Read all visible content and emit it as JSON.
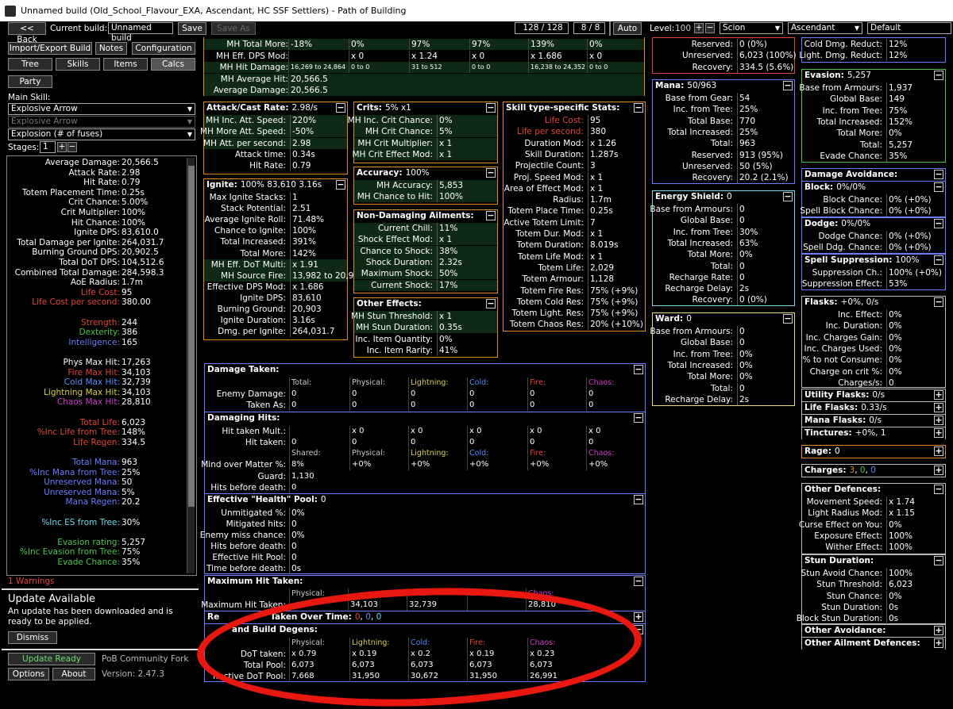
{
  "window": {
    "title": "Unnamed build (Old_School_Flavour_EXA, Ascendant, HC SSF Settlers) - Path of Building"
  },
  "toolbar": {
    "back": "<< Back",
    "current_build_label": "Current build:",
    "build_name": "Unnamed build",
    "save": "Save",
    "save_as": "Save As",
    "points": "128 / 128",
    "ascend_points": "8 / 8",
    "auto": "Auto",
    "level_label": "Level:",
    "level": "100",
    "class": "Scion",
    "ascendancy": "Ascendant",
    "config": "Default"
  },
  "left": {
    "import_export": "Import/Export Build",
    "notes": "Notes",
    "configuration": "Configuration",
    "tabs": [
      "Tree",
      "Skills",
      "Items",
      "Calcs"
    ],
    "party": "Party",
    "main_skill_label": "Main Skill:",
    "main_skill": "Explosive Arrow",
    "sub_skill": "Explosive Arrow",
    "skill_part": "Explosion (# of fuses)",
    "stages_label": "Stages:",
    "stages": "1",
    "warnings": "1 Warnings",
    "update_title": "Update Available",
    "update_text": "An update has been downloaded and is ready to be applied.",
    "dismiss": "Dismiss",
    "update_ready": "Update Ready",
    "fork": "PoB Community Fork",
    "options": "Options",
    "about": "About",
    "version": "Version: 2.47.3"
  },
  "stats": [
    {
      "l": "Average Damage:",
      "v": "20,566.5",
      "c": "#ffffff"
    },
    {
      "l": "Attack Rate:",
      "v": "2.98",
      "c": "#ffffff"
    },
    {
      "l": "Hit Rate:",
      "v": "0.79",
      "c": "#ffffff"
    },
    {
      "l": "Totem Placement Time:",
      "v": "0.25s",
      "c": "#ffffff"
    },
    {
      "l": "Crit Chance:",
      "v": "5.00%",
      "c": "#ffffff"
    },
    {
      "l": "Crit Multiplier:",
      "v": "100%",
      "c": "#ffffff"
    },
    {
      "l": "Hit Chance:",
      "v": "100%",
      "c": "#ffffff"
    },
    {
      "l": "Ignite DPS:",
      "v": "83,610.0",
      "c": "#ffffff"
    },
    {
      "l": "Total Damage per Ignite:",
      "v": "264,031.7",
      "c": "#ffffff"
    },
    {
      "l": "Burning Ground DPS:",
      "v": "20,902.5",
      "c": "#ffffff"
    },
    {
      "l": "Total DoT DPS:",
      "v": "104,512.6",
      "c": "#ffffff"
    },
    {
      "l": "Combined Total Damage:",
      "v": "284,598.3",
      "c": "#ffffff"
    },
    {
      "l": "AoE Radius:",
      "v": "1.7m",
      "c": "#ffffff"
    },
    {
      "l": "Life Cost:",
      "v": "95",
      "c": "#e0453a"
    },
    {
      "l": "Life Cost per second:",
      "v": "380.00",
      "c": "#e0453a"
    },
    {
      "l": "",
      "v": "",
      "c": "#fff"
    },
    {
      "l": "Strength:",
      "v": "244",
      "c": "#e0453a"
    },
    {
      "l": "Dexterity:",
      "v": "386",
      "c": "#4ec24e"
    },
    {
      "l": "Intelligence:",
      "v": "165",
      "c": "#6a7cff"
    },
    {
      "l": "",
      "v": "",
      "c": "#fff"
    },
    {
      "l": "Phys Max Hit:",
      "v": "17,263",
      "c": "#ffffff"
    },
    {
      "l": "Fire Max Hit:",
      "v": "34,103",
      "c": "#e0453a"
    },
    {
      "l": "Cold Max Hit:",
      "v": "32,739",
      "c": "#5b8cff"
    },
    {
      "l": "Lightning Max Hit:",
      "v": "34,103",
      "c": "#d8d24a"
    },
    {
      "l": "Chaos Max Hit:",
      "v": "28,810",
      "c": "#d03cc9"
    },
    {
      "l": "",
      "v": "",
      "c": "#fff"
    },
    {
      "l": "Total Life:",
      "v": "6,023",
      "c": "#e0453a"
    },
    {
      "l": "%Inc Life from Tree:",
      "v": "148%",
      "c": "#e0453a"
    },
    {
      "l": "Life Regen:",
      "v": "334.5",
      "c": "#e0453a"
    },
    {
      "l": "",
      "v": "",
      "c": "#fff"
    },
    {
      "l": "Total Mana:",
      "v": "963",
      "c": "#6a7cff"
    },
    {
      "l": "%Inc Mana from Tree:",
      "v": "25%",
      "c": "#6a7cff"
    },
    {
      "l": "Unreserved Mana:",
      "v": "50",
      "c": "#6a7cff"
    },
    {
      "l": "Unreserved Mana:",
      "v": "5%",
      "c": "#6a7cff"
    },
    {
      "l": "Mana Regen:",
      "v": "20.2",
      "c": "#6a7cff"
    },
    {
      "l": "",
      "v": "",
      "c": "#fff"
    },
    {
      "l": "%Inc ES from Tree:",
      "v": "30%",
      "c": "#6fd9e8"
    },
    {
      "l": "",
      "v": "",
      "c": "#fff"
    },
    {
      "l": "Evasion rating:",
      "v": "5,257",
      "c": "#4ec24e"
    },
    {
      "l": "%Inc Evasion from Tree:",
      "v": "75%",
      "c": "#4ec24e"
    },
    {
      "l": "Evade Chance:",
      "v": "35%",
      "c": "#4ec24e"
    },
    {
      "l": "",
      "v": "",
      "c": "#fff"
    },
    {
      "l": "Armour:",
      "v": "11,296",
      "c": "#ffffff"
    },
    {
      "l": "%Inc Armour from Tree:",
      "v": "98%",
      "c": "#ffffff"
    },
    {
      "l": "Phys. Damage Reduction:",
      "v": "90%",
      "c": "#ffffff"
    },
    {
      "l": "Spell Suppression Chance:",
      "v": "100%",
      "c": "#ffffff"
    }
  ],
  "mh_top": {
    "rows": [
      {
        "l": "MH Total More:",
        "v": [
          "-18%",
          "0%",
          "97%",
          "97%",
          "139%",
          "0%"
        ]
      },
      {
        "l": "MH Eff. DPS Mod:",
        "v": [
          "",
          "x 0",
          "x 1.24",
          "x 0",
          "x 1.686",
          "x 0"
        ]
      },
      {
        "l": "MH Hit Damage:",
        "v": [
          "16,269 to 24,864",
          "0 to 0",
          "31 to 512",
          "0 to 0",
          "16,238 to 24,352",
          "0 to 0"
        ]
      },
      {
        "l": "MH Average Hit:",
        "v": [
          "20,566.5"
        ]
      },
      {
        "l": "Average Damage:",
        "v": [
          "20,566.5"
        ]
      }
    ]
  },
  "attack": {
    "title": "Attack/Cast Rate:",
    "value": "2.98/s",
    "rows": [
      {
        "l": "MH Inc. Att. Speed:",
        "v": "220%"
      },
      {
        "l": "MH More Att. Speed:",
        "v": "-50%"
      },
      {
        "l": "MH Att. per second:",
        "v": "2.98"
      },
      {
        "l": "Attack time:",
        "v": "0.34s"
      },
      {
        "l": "Hit Rate:",
        "v": "0.79"
      }
    ]
  },
  "ignite": {
    "title": "Ignite:",
    "value": "100% 83,610 3.16s",
    "rows": [
      {
        "l": "Max Ignite Stacks:",
        "v": "1"
      },
      {
        "l": "Stack Potential:",
        "v": "2.51"
      },
      {
        "l": "Average Ignite Roll:",
        "v": "71.48%"
      },
      {
        "l": "Chance to Ignite:",
        "v": "100%"
      },
      {
        "l": "Total Increased:",
        "v": "391%"
      },
      {
        "l": "Total More:",
        "v": "142%"
      },
      {
        "l": "MH Eff. DoT Multi:",
        "v": "x 1.91"
      },
      {
        "l": "MH Source Fire:",
        "v": "13,982 to 20,967"
      },
      {
        "l": "Effective DPS Mod:",
        "v": "x 1.686"
      },
      {
        "l": "Ignite DPS:",
        "v": "83,610"
      },
      {
        "l": "Burning Ground:",
        "v": "20,903"
      },
      {
        "l": "Ignite Duration:",
        "v": "3.16s"
      },
      {
        "l": "Dmg. per Ignite:",
        "v": "264,031.7"
      }
    ]
  },
  "crits": {
    "title": "Crits:",
    "value": "5% x1",
    "rows": [
      {
        "l": "MH Inc. Crit Chance:",
        "v": "0%"
      },
      {
        "l": "MH Crit Chance:",
        "v": "5%"
      },
      {
        "l": "MH Crit Multiplier:",
        "v": "x 1"
      },
      {
        "l": "MH Crit Effect Mod:",
        "v": "x 1"
      }
    ]
  },
  "accuracy": {
    "title": "Accuracy:",
    "value": "100%",
    "rows": [
      {
        "l": "MH Accuracy:",
        "v": "5,853"
      },
      {
        "l": "MH Chance to Hit:",
        "v": "100%"
      }
    ]
  },
  "nondmg": {
    "title": "Non-Damaging Ailments:",
    "rows": [
      {
        "l": "Current Chill:",
        "v": "11%"
      },
      {
        "l": "Shock Effect Mod:",
        "v": "x 1"
      },
      {
        "l": "Chance to Shock:",
        "v": "38%"
      },
      {
        "l": "Shock Duration:",
        "v": "2.32s"
      },
      {
        "l": "Maximum Shock:",
        "v": "50%"
      },
      {
        "l": "Current Shock:",
        "v": "17%"
      }
    ]
  },
  "other_effects": {
    "title": "Other Effects:",
    "rows": [
      {
        "l": "MH Stun Threshold:",
        "v": "x 1"
      },
      {
        "l": "MH Stun Duration:",
        "v": "0.35s"
      },
      {
        "l": "Inc. Item Quantity:",
        "v": "0%"
      },
      {
        "l": "Inc. Item Rarity:",
        "v": "41%"
      }
    ]
  },
  "skilltype": {
    "title": "Skill type-specific Stats:",
    "rows": [
      {
        "l": "Life Cost:",
        "v": "95",
        "c": "#e0453a"
      },
      {
        "l": "Life per second:",
        "v": "380",
        "c": "#e0453a"
      },
      {
        "l": "Duration Mod:",
        "v": "x 1.26",
        "c": "#fff"
      },
      {
        "l": "Skill Duration:",
        "v": "1.287s",
        "c": "#fff"
      },
      {
        "l": "Projectile Count:",
        "v": "3",
        "c": "#fff"
      },
      {
        "l": "Proj. Speed Mod:",
        "v": "x 1",
        "c": "#fff"
      },
      {
        "l": "Area of Effect Mod:",
        "v": "x 1",
        "c": "#fff"
      },
      {
        "l": "Radius:",
        "v": "1.7m",
        "c": "#fff"
      },
      {
        "l": "Totem Place Time:",
        "v": "0.25s",
        "c": "#fff"
      },
      {
        "l": "Active Totem Limit:",
        "v": "7",
        "c": "#fff"
      },
      {
        "l": "Totem Dur. Mod:",
        "v": "x 1",
        "c": "#fff"
      },
      {
        "l": "Totem Duration:",
        "v": "8.019s",
        "c": "#fff"
      },
      {
        "l": "Totem Life Mod:",
        "v": "x 1",
        "c": "#fff"
      },
      {
        "l": "Totem Life:",
        "v": "2,029",
        "c": "#fff"
      },
      {
        "l": "Totem Armour:",
        "v": "1,128",
        "c": "#fff"
      },
      {
        "l": "Totem Fire Res:",
        "v": "75% (+9%)",
        "c": "#fff"
      },
      {
        "l": "Totem Cold Res:",
        "v": "75% (+9%)",
        "c": "#fff"
      },
      {
        "l": "Totem Light. Res:",
        "v": "75% (+9%)",
        "c": "#fff"
      },
      {
        "l": "Totem Chaos Res:",
        "v": "20% (+10%)",
        "c": "#fff"
      }
    ]
  },
  "life_top": {
    "rows": [
      {
        "l": "Reserved:",
        "v": "0 (0%)"
      },
      {
        "l": "Unreserved:",
        "v": "6,023 (100%)"
      },
      {
        "l": "Recovery:",
        "v": "334.5 (5.6%)"
      }
    ]
  },
  "mana": {
    "title": "Mana:",
    "value": "50/963",
    "rows": [
      {
        "l": "Base from Gear:",
        "v": "54"
      },
      {
        "l": "Inc. from Tree:",
        "v": "25%"
      },
      {
        "l": "Total Base:",
        "v": "770"
      },
      {
        "l": "Total Increased:",
        "v": "25%"
      },
      {
        "l": "Total:",
        "v": "963"
      },
      {
        "l": "Reserved:",
        "v": "913 (95%)"
      },
      {
        "l": "Unreserved:",
        "v": "50 (5%)"
      },
      {
        "l": "Recovery:",
        "v": "20.2 (2.1%)"
      }
    ]
  },
  "es": {
    "title": "Energy Shield:",
    "value": "0",
    "rows": [
      {
        "l": "Base from Armours:",
        "v": "0"
      },
      {
        "l": "Global Base:",
        "v": "0"
      },
      {
        "l": "Inc. from Tree:",
        "v": "30%"
      },
      {
        "l": "Total Increased:",
        "v": "63%"
      },
      {
        "l": "Total More:",
        "v": "0%"
      },
      {
        "l": "Total:",
        "v": "0"
      },
      {
        "l": "Recharge Rate:",
        "v": "0"
      },
      {
        "l": "Recharge Delay:",
        "v": "2s"
      },
      {
        "l": "Recovery:",
        "v": "0 (0%)"
      }
    ]
  },
  "ward": {
    "title": "Ward:",
    "value": "0",
    "rows": [
      {
        "l": "Base from Armours:",
        "v": "0"
      },
      {
        "l": "Global Base:",
        "v": "0"
      },
      {
        "l": "Inc. from Tree:",
        "v": "0%"
      },
      {
        "l": "Total Increased:",
        "v": "0%"
      },
      {
        "l": "Total More:",
        "v": "0%"
      },
      {
        "l": "Total:",
        "v": "0"
      },
      {
        "l": "Recharge Delay:",
        "v": "2s"
      }
    ]
  },
  "res_top": {
    "rows": [
      {
        "l": "Cold Dmg. Reduct:",
        "v": "12%"
      },
      {
        "l": "Light. Dmg. Reduct:",
        "v": "12%"
      }
    ]
  },
  "evasion": {
    "title": "Evasion:",
    "value": "5,257",
    "rows": [
      {
        "l": "Base from Armours:",
        "v": "1,937"
      },
      {
        "l": "Global Base:",
        "v": "149"
      },
      {
        "l": "Inc. from Tree:",
        "v": "75%"
      },
      {
        "l": "Total Increased:",
        "v": "152%"
      },
      {
        "l": "Total More:",
        "v": "0%"
      },
      {
        "l": "Total:",
        "v": "5,257"
      },
      {
        "l": "Evade Chance:",
        "v": "35%"
      }
    ]
  },
  "avoid": {
    "title": "Damage Avoidance:",
    "block_title": "Block:",
    "block_value": "0%/0%",
    "block_rows": [
      {
        "l": "Block Chance:",
        "v": "0% (+0%)"
      },
      {
        "l": "Spell Block Chance:",
        "v": "0% (+0%)"
      }
    ],
    "dodge_title": "Dodge:",
    "dodge_value": "0%/0%",
    "dodge_rows": [
      {
        "l": "Dodge Chance:",
        "v": "0% (+0%)"
      },
      {
        "l": "Spell Ddg. Chance:",
        "v": "0% (+0%)"
      }
    ],
    "supp_title": "Spell Suppression:",
    "supp_value": "100%",
    "supp_rows": [
      {
        "l": "Suppression Ch.:",
        "v": "100% (+0%)"
      },
      {
        "l": "Suppression Effect:",
        "v": "53%"
      }
    ]
  },
  "flasks": {
    "title": "Flasks:",
    "value": "+0%, 0/s",
    "rows": [
      {
        "l": "Inc. Effect:",
        "v": "0%"
      },
      {
        "l": "Inc. Duration:",
        "v": "0%"
      },
      {
        "l": "Inc. Charges Gain:",
        "v": "0%"
      },
      {
        "l": "Inc. Charges Used:",
        "v": "0%"
      },
      {
        "l": "% to not Consume:",
        "v": "0%"
      },
      {
        "l": "Charge on crit %:",
        "v": "0%"
      },
      {
        "l": "Charges/s:",
        "v": "0"
      }
    ],
    "utility": "Utility Flasks:",
    "utility_v": "0/s",
    "life": "Life Flasks:",
    "life_v": "0.33/s",
    "mana": "Mana Flasks:",
    "mana_v": "0/s",
    "tinctures": "Tinctures:",
    "tinctures_v": "+0%, 1"
  },
  "rage": {
    "title": "Rage:",
    "value": "0"
  },
  "charges": {
    "title": "Charges:",
    "v1": "3",
    "v2": "0",
    "v3": "0"
  },
  "otherdef": {
    "title": "Other Defences:",
    "rows": [
      {
        "l": "Movement Speed:",
        "v": "x 1.74"
      },
      {
        "l": "Light Radius Mod:",
        "v": "x 1.15"
      },
      {
        "l": "Curse Effect on You:",
        "v": "0%"
      },
      {
        "l": "Exposure Effect:",
        "v": "100%"
      },
      {
        "l": "Wither Effect:",
        "v": "100%"
      }
    ]
  },
  "stun": {
    "title": "Stun Duration:",
    "rows": [
      {
        "l": "Stun Avoid Chance:",
        "v": "100%"
      },
      {
        "l": "Stun Threshold:",
        "v": "6,023"
      },
      {
        "l": "Stun Chance:",
        "v": "0%"
      },
      {
        "l": "Stun Duration:",
        "v": "0s"
      },
      {
        "l": "Block Stun Duration:",
        "v": "0s"
      }
    ]
  },
  "other_avoid": "Other Avoidance:",
  "other_ailment": "Other Ailment Defences:",
  "dmg_taken": {
    "title": "Damage Taken:",
    "cols": [
      "Total:",
      "Physical:",
      "Lightning:",
      "Cold:",
      "Fire:",
      "Chaos:"
    ],
    "rows": [
      {
        "l": "Enemy Damage:",
        "v": [
          "0",
          "0",
          "0",
          "0",
          "0",
          "0"
        ]
      },
      {
        "l": "Taken As:",
        "v": [
          "0",
          "0",
          "0",
          "0",
          "0",
          "0"
        ]
      }
    ]
  },
  "dmg_hits": {
    "title": "Damaging Hits:",
    "rows1": [
      {
        "l": "Hit taken Mult.:",
        "v": [
          "",
          "x 0",
          "x 0",
          "x 0",
          "x 0",
          "x 0"
        ]
      },
      {
        "l": "Hit taken:",
        "v": [
          "0",
          "0",
          "0",
          "0",
          "0",
          "0"
        ]
      }
    ],
    "cols2": [
      "Shared:",
      "Physical:",
      "Lightning:",
      "Cold:",
      "Fire:",
      "Chaos:"
    ],
    "rows2": [
      {
        "l": "Mind over Matter %:",
        "v": [
          "8%",
          "+0%",
          "+0%",
          "+0%",
          "+0%",
          "+0%"
        ]
      },
      {
        "l": "Guard:",
        "v": [
          "1,130"
        ]
      },
      {
        "l": "Hits before death:",
        "v": [
          "0"
        ]
      }
    ]
  },
  "ehp": {
    "title": "Effective \"Health\" Pool:",
    "value": "0",
    "rows": [
      {
        "l": "Unmitigated %:",
        "v": "0%"
      },
      {
        "l": "Mitigated hits:",
        "v": "0"
      },
      {
        "l": "Enemy miss chance:",
        "v": "0%"
      },
      {
        "l": "Hits before death:",
        "v": "0"
      },
      {
        "l": "Effective Hit Pool:",
        "v": "0"
      },
      {
        "l": "Time before death:",
        "v": "0s"
      }
    ]
  },
  "maxhit": {
    "title": "Maximum Hit Taken:",
    "cols": [
      "Physical:",
      "",
      "Cold:",
      "Fire:",
      "Chaos:"
    ],
    "row_l": "Maximum Hit Taken:",
    "vals": [
      "",
      "34,103",
      "32,739",
      "",
      "28,810"
    ]
  },
  "overtime": {
    "title_a": "Re",
    "title_b": "Taken Over Time:",
    "v1": "0",
    "v2": "0",
    "v3": "0"
  },
  "degens": {
    "title": "and Build Degens:",
    "cols": [
      "Physical:",
      "Lightning:",
      "Cold:",
      "Fire:",
      "Chaos:"
    ],
    "rows": [
      {
        "l": "DoT taken:",
        "v": [
          "x 0.79",
          "x 0.19",
          "x 0.2",
          "x 0.19",
          "x 0.23"
        ]
      },
      {
        "l": "Total Pool:",
        "v": [
          "6,073",
          "6,073",
          "6,073",
          "6,073",
          "6,073"
        ]
      },
      {
        "l": "ffective DoT Pool:",
        "v": [
          "7,668",
          "31,950",
          "30,672",
          "31,950",
          "26,991"
        ]
      }
    ]
  }
}
